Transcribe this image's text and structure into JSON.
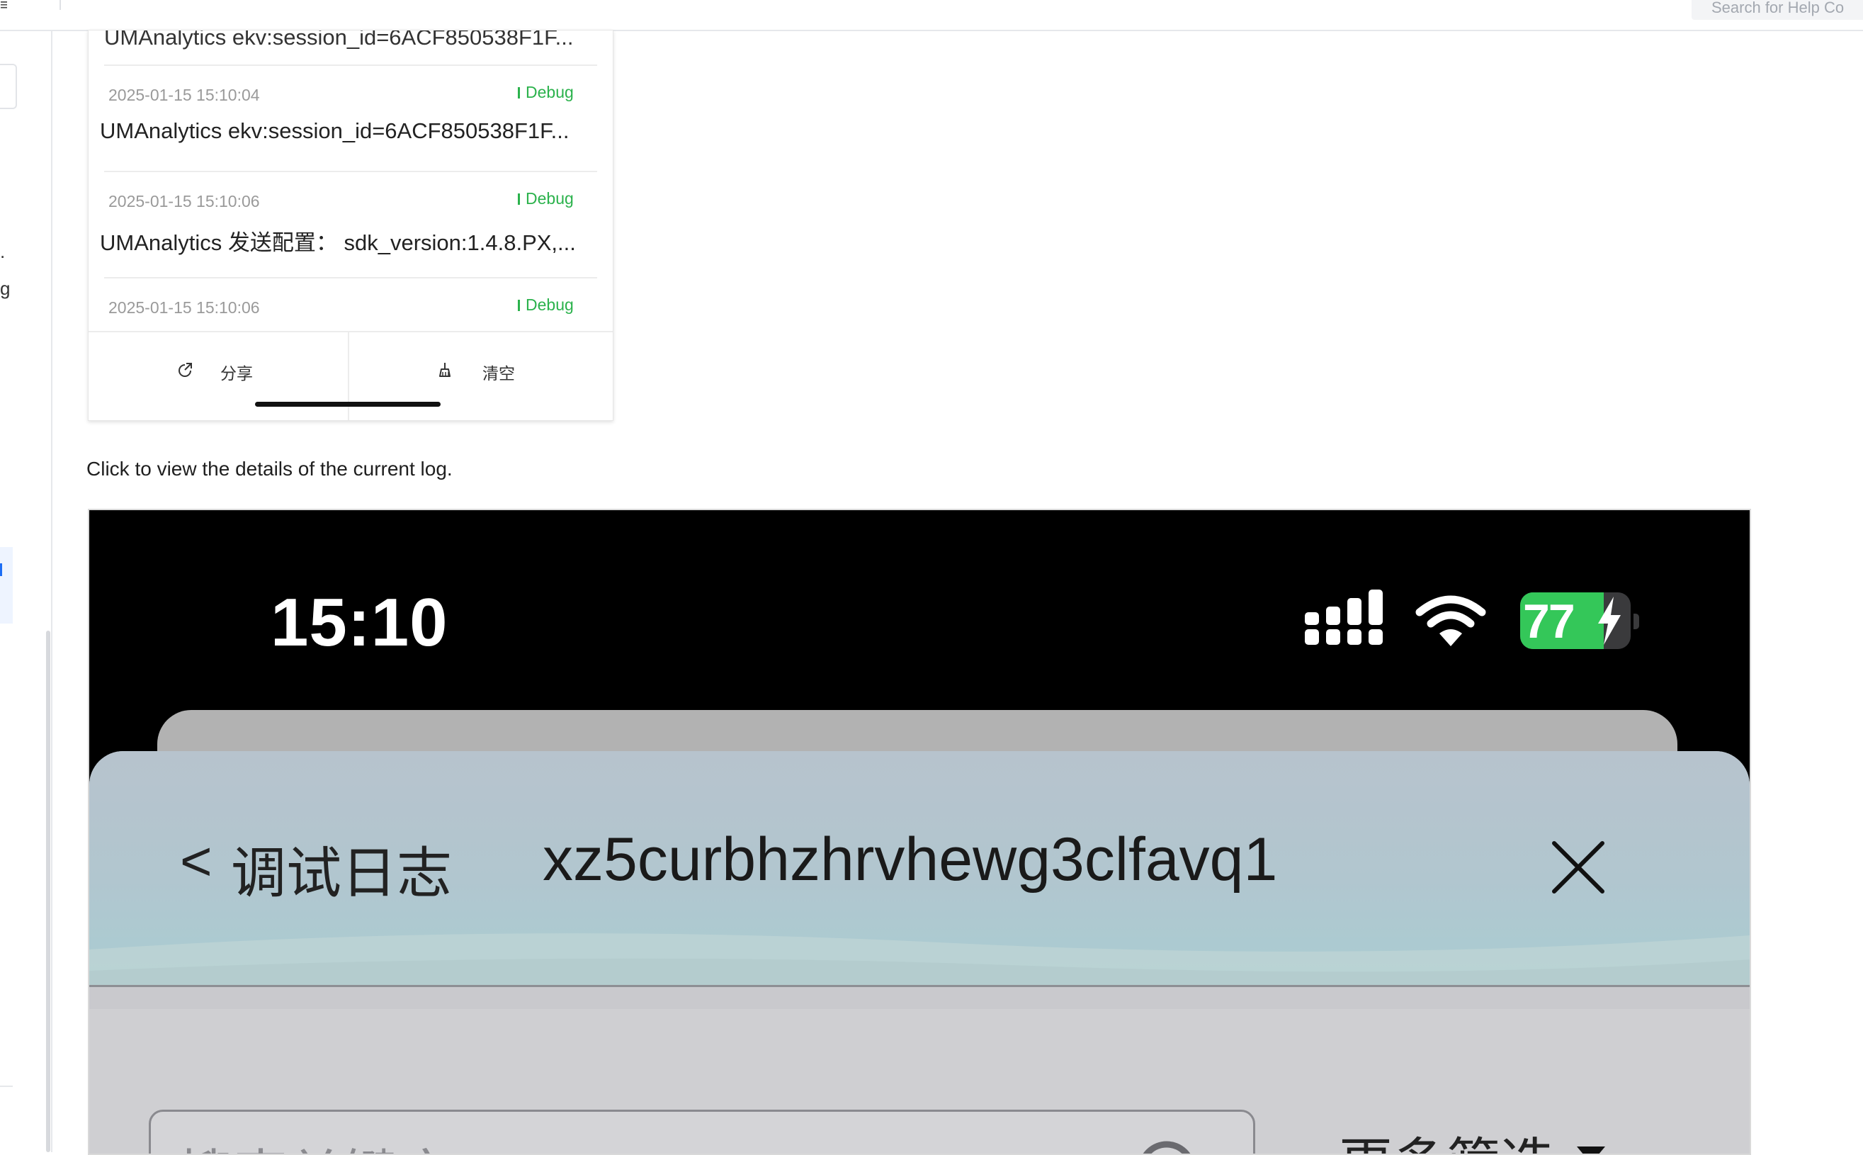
{
  "topbar": {
    "search_placeholder": "Search for Help Co",
    "menu_glyph": "≡"
  },
  "sidebar": {
    "fragment_dot": ".",
    "fragment_g": "g"
  },
  "log_screenshot": {
    "first_message": "UMAnalytics ekv:session_id=6ACF850538F1F...",
    "entries": [
      {
        "timestamp": "2025-01-15 15:10:04",
        "level": "Debug",
        "message": "UMAnalytics ekv:session_id=6ACF850538F1F..."
      },
      {
        "timestamp": "2025-01-15 15:10:06",
        "level": "Debug",
        "message": "UMAnalytics 发送配置： sdk_version:1.4.8.PX,..."
      },
      {
        "timestamp": "2025-01-15 15:10:06",
        "level": "Debug",
        "message": ""
      }
    ],
    "share_label": "分享",
    "clear_label": "清空"
  },
  "caption": "Click to view the details of the current log.",
  "phone_screenshot": {
    "status_bar": {
      "time": "15:10",
      "battery": "77"
    },
    "header": {
      "back_chevron": "<",
      "back_label": "调试日志",
      "app_key": "xz5curbhzhrvhewg3clfavq1"
    },
    "filter": {
      "keyword_placeholder": "搜索关键字",
      "more_filter_label": "更多筛选"
    }
  },
  "colors": {
    "debug_green": "#2bb24c",
    "battery_green": "#34c759",
    "accent_blue": "#1d6ef5"
  }
}
